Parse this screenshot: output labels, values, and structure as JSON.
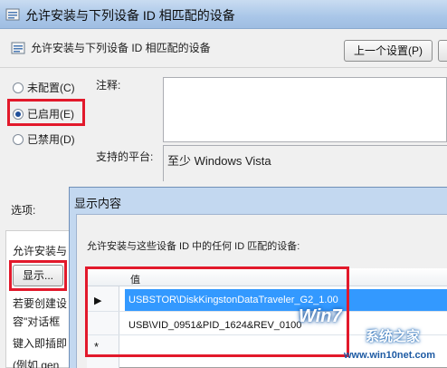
{
  "window": {
    "title": "允许安装与下列设备 ID 相匹配的设备",
    "setting_name": "允许安装与下列设备 ID 相匹配的设备",
    "prev_button": "上一个设置(P)"
  },
  "state_options": [
    {
      "label": "未配置(C)",
      "checked": false
    },
    {
      "label": "已启用(E)",
      "checked": true
    },
    {
      "label": "已禁用(D)",
      "checked": false
    }
  ],
  "labels": {
    "comment": "注释:",
    "platform": "支持的平台:",
    "platform_value": "至少 Windows Vista",
    "options": "选项:"
  },
  "options_panel": {
    "line1": "允许安装与",
    "show_button": "显示...",
    "line2": "若要创建设",
    "line3": "容\"对话框",
    "line4": "键入即插即",
    "line5": "(例如 gen"
  },
  "show_contents": {
    "title": "显示内容",
    "description": "允许安装与这些设备 ID 中的任何 ID 匹配的设备:",
    "column_header": "值",
    "rows": [
      {
        "marker": "▶",
        "value": "USBSTOR\\DiskKingstonDataTraveler_G2_1.00",
        "selected": true
      },
      {
        "marker": "",
        "value": "USB\\VID_0951&PID_1624&REV_0100",
        "selected": false
      },
      {
        "marker": "*",
        "value": "",
        "selected": false
      }
    ]
  },
  "watermark": {
    "logo": "Win7",
    "brand": "系统之家",
    "url": "www.win10net.com"
  },
  "colors": {
    "highlight_box": "#e2192b",
    "selection": "#3399ff"
  }
}
